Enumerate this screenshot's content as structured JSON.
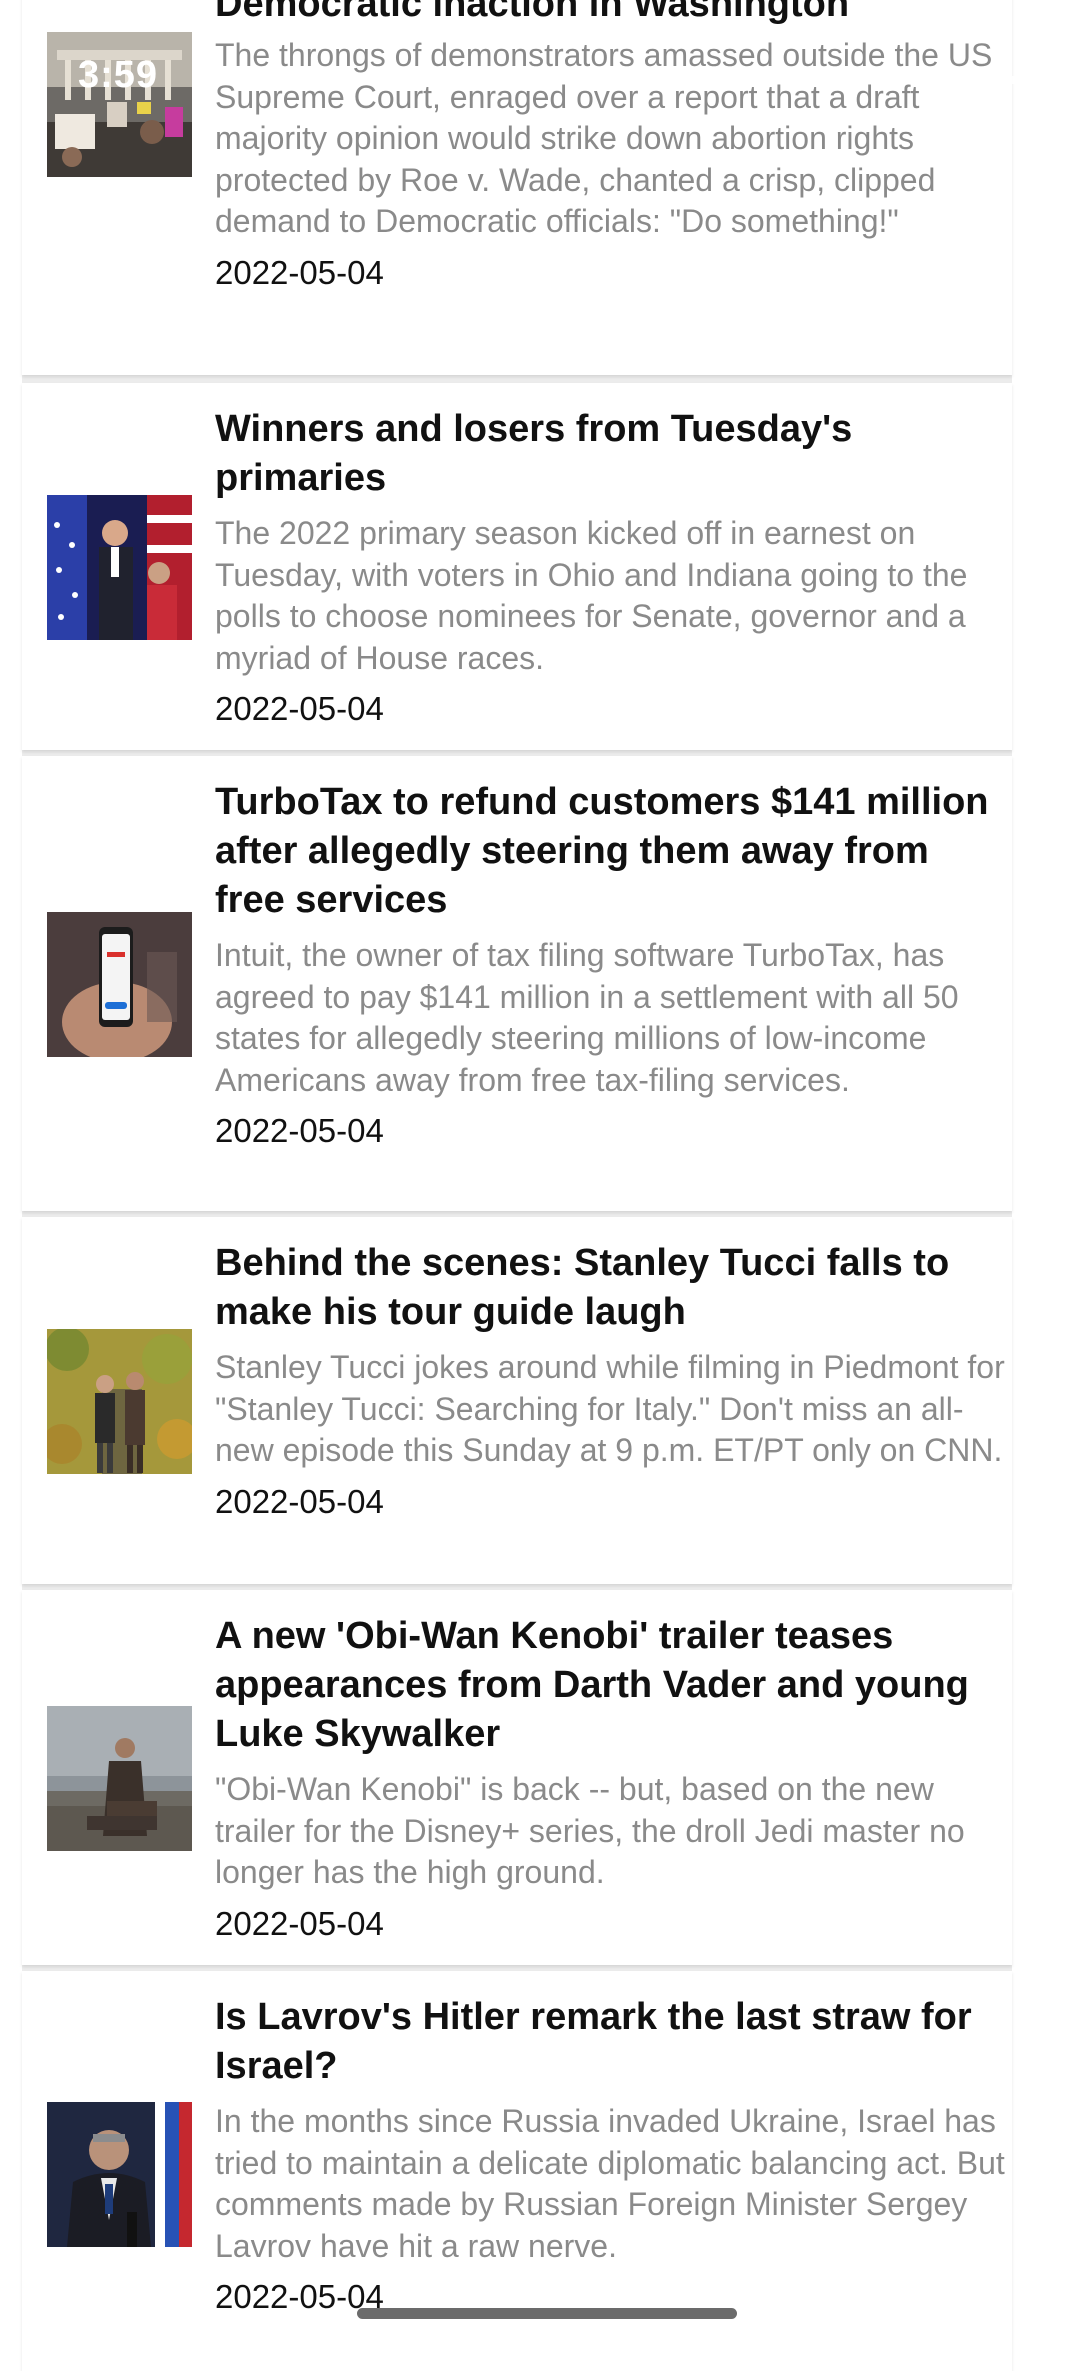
{
  "status_bar": {
    "time": "3:59"
  },
  "articles": [
    {
      "title": "Democratic inaction in Washington",
      "description": "The throngs of demonstrators amassed outside the US Supreme Court, enraged over a report that a draft majority opinion would strike down abortion rights protected by Roe v. Wade, chanted a crisp, clipped demand to Democratic officials: \"Do something!\"",
      "date": "2022-05-04",
      "thumbnail": "protest-photo"
    },
    {
      "title": "Winners and losers from Tuesday's primaries",
      "description": "The 2022 primary season kicked off in earnest on Tuesday, with voters in Ohio and Indiana going to the polls to choose nominees for Senate, governor and a myriad of House races.",
      "date": "2022-05-04",
      "thumbnail": "candidate-stage-photo"
    },
    {
      "title": "TurboTax to refund customers $141 million after allegedly steering them away from free services",
      "description": "Intuit, the owner of tax filing software TurboTax, has agreed to pay $141 million in a settlement with all 50 states for allegedly steering millions of low-income Americans away from free tax-filing services.",
      "date": "2022-05-04",
      "thumbnail": "phone-in-hand-photo"
    },
    {
      "title": "Behind the scenes: Stanley Tucci falls to make his tour guide laugh",
      "description": "Stanley Tucci jokes around while filming in Piedmont for \"Stanley Tucci: Searching for Italy.\" Don't miss an all-new episode this Sunday at 9 p.m. ET/PT only on CNN.",
      "date": "2022-05-04",
      "thumbnail": "vineyard-walk-photo"
    },
    {
      "title": "A new 'Obi-Wan Kenobi' trailer teases appearances from Darth Vader and young Luke Skywalker",
      "description": "\"Obi-Wan Kenobi\" is back -- but, based on the new trailer for the Disney+ series, the droll Jedi master no longer has the high ground.",
      "date": "2022-05-04",
      "thumbnail": "desert-rider-photo"
    },
    {
      "title": "Is Lavrov's Hitler remark the last straw for Israel?",
      "description": "In the months since Russia invaded Ukraine, Israel has tried to maintain a delicate diplomatic balancing act. But comments made by Russian Foreign Minister Sergey Lavrov have hit a raw nerve.",
      "date": "2022-05-04",
      "thumbnail": "minister-podium-photo"
    }
  ]
}
